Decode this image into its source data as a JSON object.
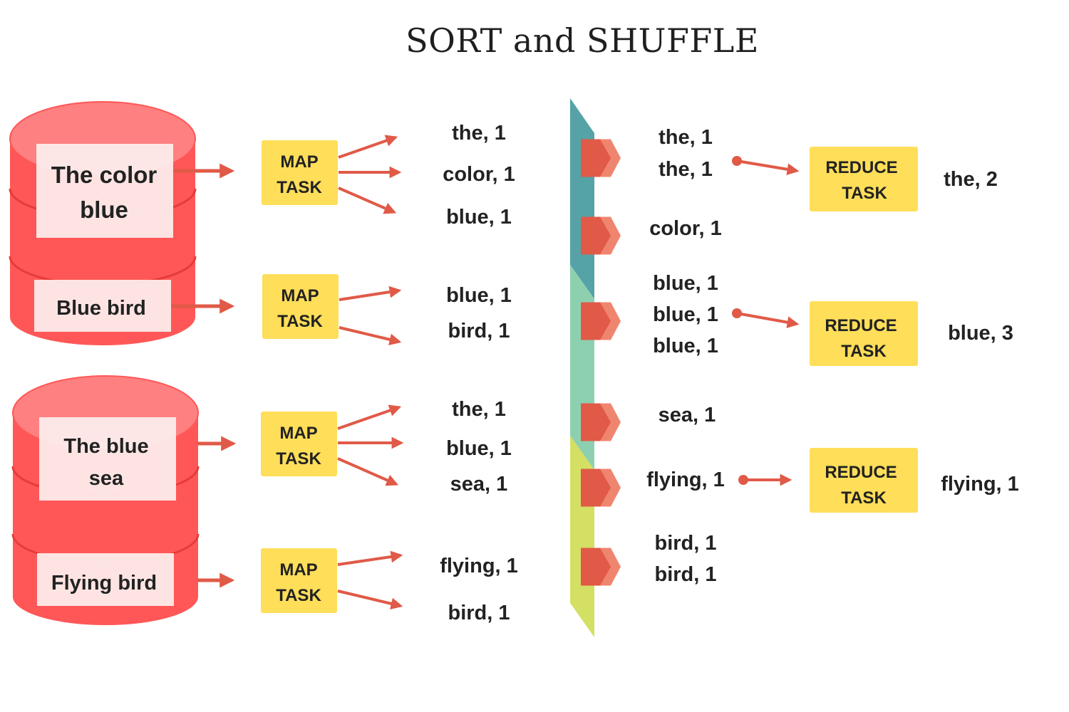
{
  "title": "SORT and SHUFFLE",
  "colors": {
    "cylinder_body": "#ff5757",
    "cylinder_top": "#ff8080",
    "cylinder_rim": "#e83a3a",
    "label_box": "#fdeceb",
    "arrow": "#e05a47",
    "task_box": "#ffde59",
    "shuffle_segment_1": "#55a3a6",
    "shuffle_segment_2": "#8dd0b0",
    "shuffle_segment_3": "#d4e063",
    "marker_dark": "#e05a47",
    "marker_light": "#f0856f"
  },
  "inputs": [
    {
      "text_lines": [
        "The color",
        "blue"
      ]
    },
    {
      "text_lines": [
        "Blue bird"
      ]
    },
    {
      "text_lines": [
        "The blue",
        "sea"
      ]
    },
    {
      "text_lines": [
        "Flying bird"
      ]
    }
  ],
  "map_tasks": [
    {
      "lines": [
        "MAP",
        "TASK"
      ],
      "outputs": [
        "the, 1",
        "color, 1",
        "blue, 1"
      ]
    },
    {
      "lines": [
        "MAP",
        "TASK"
      ],
      "outputs": [
        "blue, 1",
        "bird, 1"
      ]
    },
    {
      "lines": [
        "MAP",
        "TASK"
      ],
      "outputs": [
        "the, 1",
        "blue, 1",
        "sea, 1"
      ]
    },
    {
      "lines": [
        "MAP",
        "TASK"
      ],
      "outputs": [
        "flying, 1",
        "bird, 1"
      ]
    }
  ],
  "shuffle_groups": [
    {
      "items": [
        "the, 1",
        "the, 1"
      ],
      "reduce_index": 0
    },
    {
      "items": [
        "color, 1"
      ],
      "reduce_index": null
    },
    {
      "items": [
        "blue, 1",
        "blue, 1",
        "blue, 1"
      ],
      "reduce_index": 1
    },
    {
      "items": [
        "sea, 1"
      ],
      "reduce_index": null
    },
    {
      "items": [
        "flying, 1"
      ],
      "reduce_index": 2
    },
    {
      "items": [
        "bird, 1",
        "bird, 1"
      ],
      "reduce_index": null
    }
  ],
  "reduce_tasks": [
    {
      "lines": [
        "REDUCE",
        "TASK"
      ],
      "result": "the, 2"
    },
    {
      "lines": [
        "REDUCE",
        "TASK"
      ],
      "result": "blue, 3"
    },
    {
      "lines": [
        "REDUCE",
        "TASK"
      ],
      "result": "flying, 1"
    }
  ]
}
